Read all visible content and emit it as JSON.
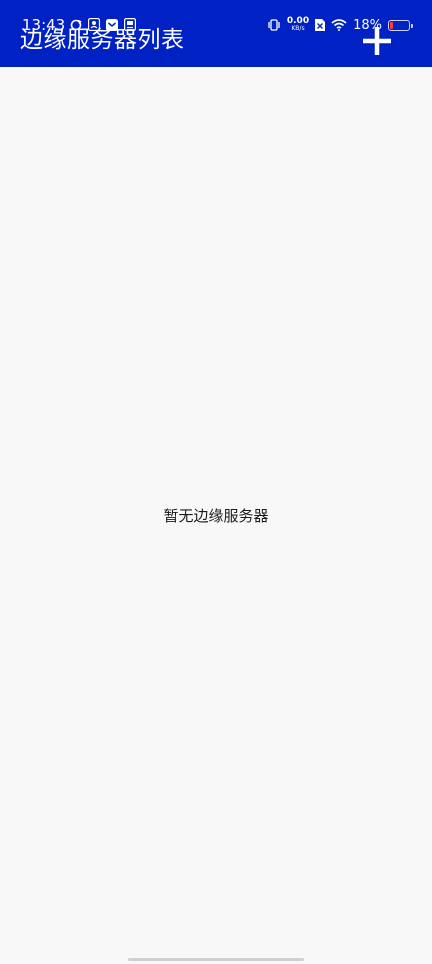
{
  "status_bar": {
    "time": "13:43",
    "net_speed_value": "0.00",
    "net_speed_unit": "KB/s",
    "battery_percent": "18%",
    "battery_level": 0.18
  },
  "app_bar": {
    "title": "边缘服务器列表",
    "background": "#0022c4"
  },
  "main": {
    "empty_message": "暂无边缘服务器"
  }
}
